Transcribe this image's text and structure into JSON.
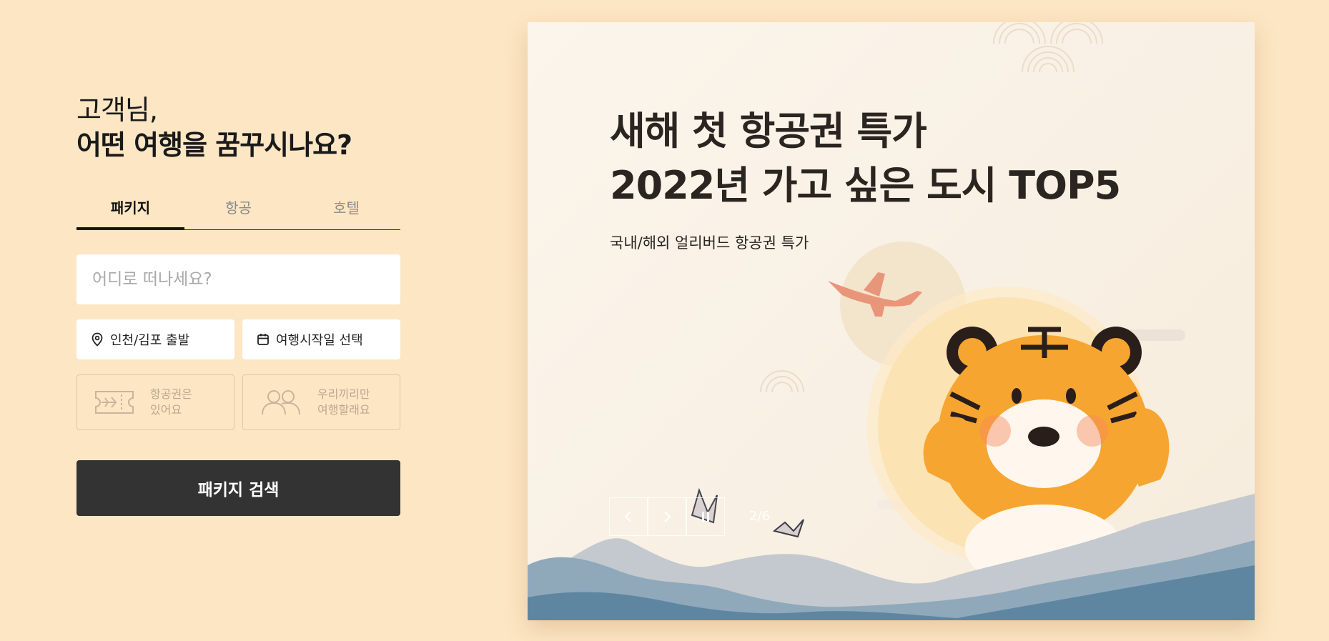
{
  "greeting": {
    "line1": "고객님,",
    "line2": "어떤 여행을 꿈꾸시나요?"
  },
  "tabs": [
    {
      "label": "패키지",
      "active": true
    },
    {
      "label": "항공",
      "active": false
    },
    {
      "label": "호텔",
      "active": false
    }
  ],
  "search": {
    "destination_placeholder": "어디로 떠나세요?",
    "departure": "인천/김포 출발",
    "date": "여행시작일 선택",
    "option_flight_line1": "항공권은",
    "option_flight_line2": "있어요",
    "option_group_line1": "우리끼리만",
    "option_group_line2": "여행할래요",
    "button": "패키지 검색"
  },
  "banner": {
    "title_line1": "새해 첫 항공권 특가",
    "title_line2": "2022년 가고 싶은 도시 TOP5",
    "subtitle": "국내/해외 얼리버드 항공권 특가",
    "counter": "2/6"
  },
  "colors": {
    "page_bg": "#fde6c4",
    "button_bg": "#333333",
    "tiger_orange": "#f7a531",
    "mountain_blue": "#5f86a1"
  },
  "icons": [
    "location-pin-icon",
    "calendar-icon",
    "ticket-plane-icon",
    "people-icon",
    "chevron-left-icon",
    "chevron-right-icon",
    "pause-icon"
  ]
}
